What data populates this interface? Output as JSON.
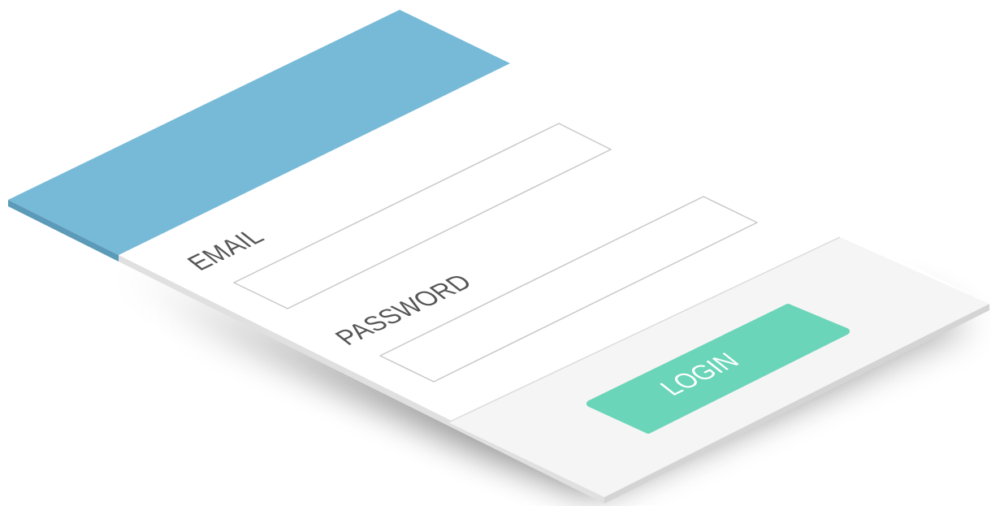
{
  "login_form": {
    "email_label": "EMAIL",
    "email_value": "",
    "password_label": "PASSWORD",
    "password_value": "",
    "login_button_label": "LOGIN"
  },
  "colors": {
    "header": "#77bad8",
    "header_edge": "#5b9ab8",
    "card": "#ffffff",
    "footer": "#f5f5f5",
    "button": "#6ad5b8",
    "input_border": "#c8c8c8"
  }
}
